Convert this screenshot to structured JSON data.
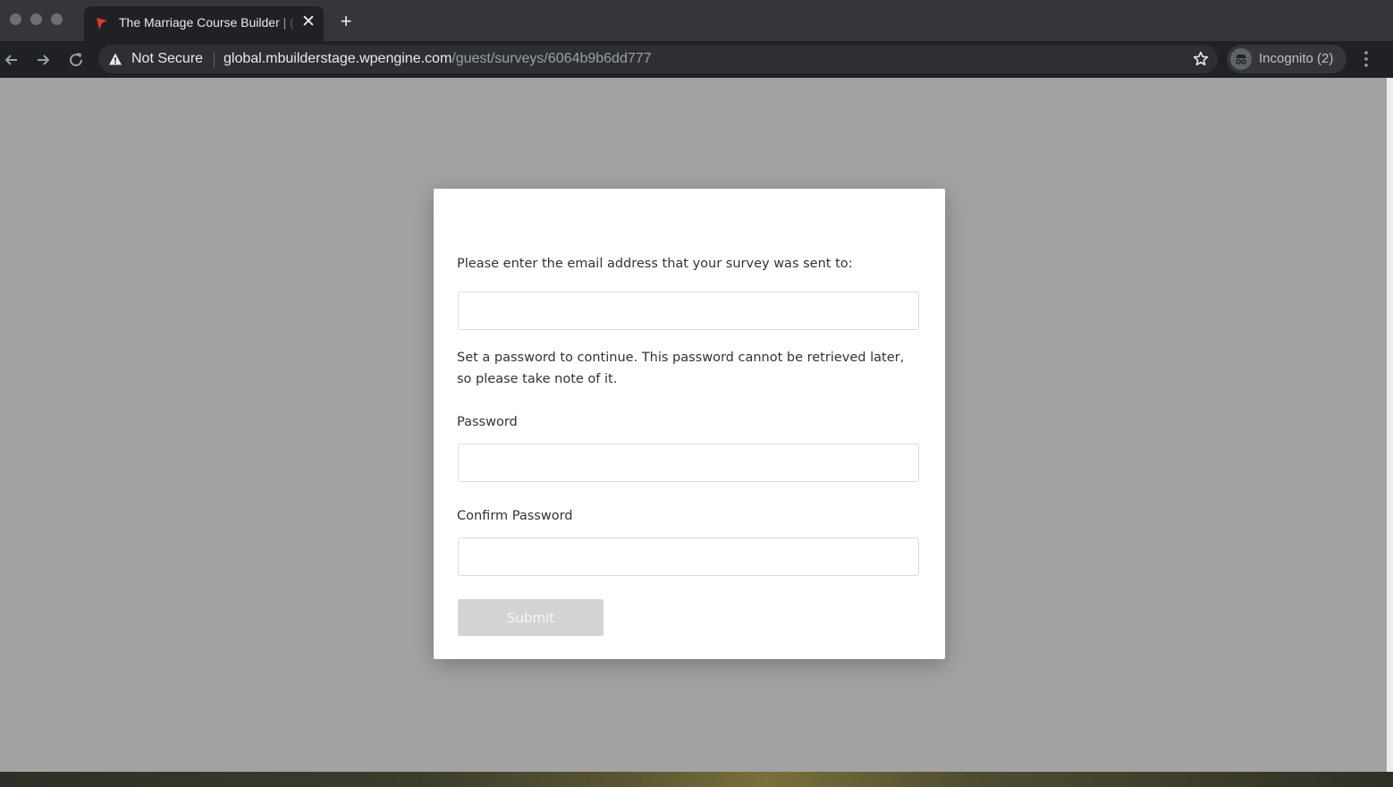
{
  "browser": {
    "tab": {
      "title": "The Marriage Course Builder | (",
      "close_glyph": "✕"
    },
    "new_tab_glyph": "+",
    "address_bar": {
      "security_label": "Not Secure",
      "url_host": "global.mbuilderstage.wpengine.com",
      "url_path": "/guest/surveys/6064b9b6dd777"
    },
    "profile": {
      "label": "Incognito (2)",
      "icon": "incognito-icon"
    },
    "icons": [
      "back-icon",
      "forward-icon",
      "reload-icon",
      "warning-icon",
      "star-icon",
      "menu-icon"
    ],
    "colors": {
      "tab_favicon": "#d9372c"
    }
  },
  "form": {
    "email_prompt": "Please enter the email address that your survey was sent to:",
    "email_value": "",
    "password_notice": "Set a password to continue. This password cannot be retrieved later, so please take note of it.",
    "password_label": "Password",
    "password_value": "",
    "confirm_label": "Confirm Password",
    "confirm_value": "",
    "submit_label": "Submit",
    "submit_enabled": false
  }
}
